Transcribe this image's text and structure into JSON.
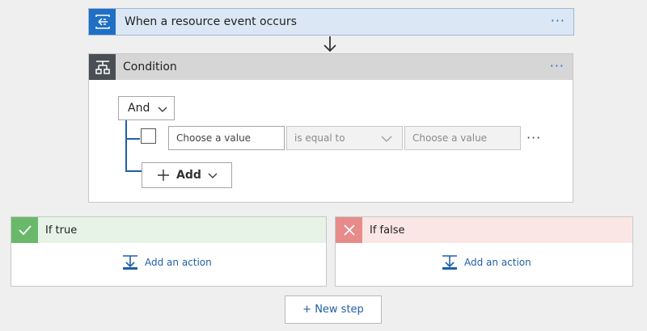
{
  "trigger": {
    "title": "When a resource event occurs",
    "icon": "event-grid-icon",
    "menu": "···"
  },
  "condition": {
    "title": "Condition",
    "icon": "condition-icon",
    "menu": "···",
    "group_operator": "And",
    "row": {
      "left_placeholder": "Choose a value",
      "operator": "is equal to",
      "right_placeholder": "Choose a value",
      "menu": "···"
    },
    "add_label": "Add"
  },
  "branches": {
    "if_true": {
      "title": "If true",
      "add_action": "Add an action",
      "color": "#6ab86a"
    },
    "if_false": {
      "title": "If false",
      "add_action": "Add an action",
      "color": "#e88b8b"
    }
  },
  "new_step": "+ New step",
  "colors": {
    "accent": "#1f6fc4",
    "link": "#1f5fa8"
  }
}
